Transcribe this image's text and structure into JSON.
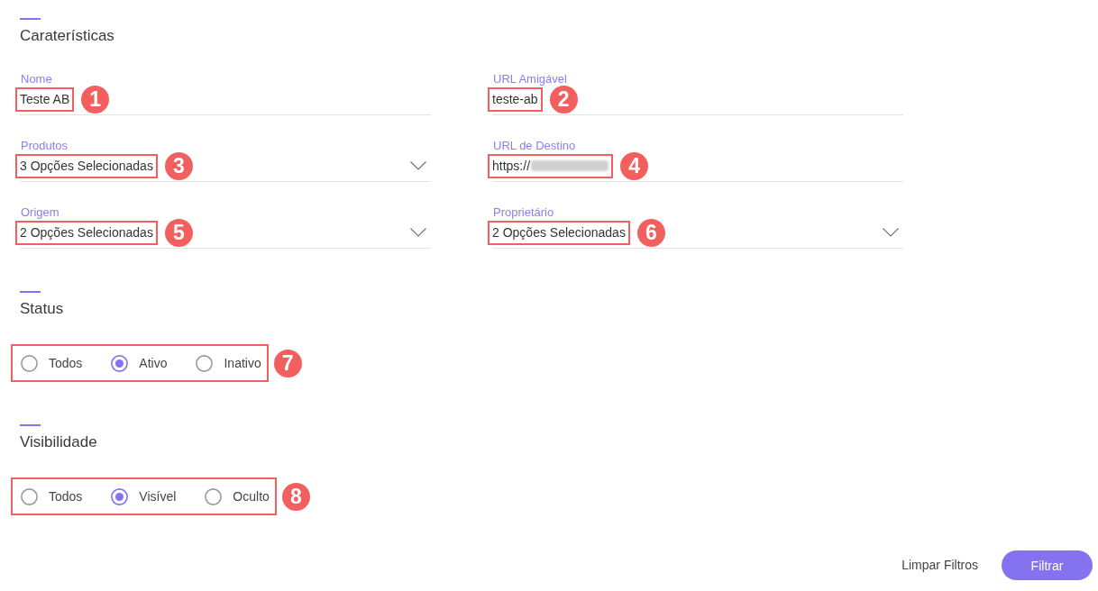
{
  "sections": [
    {
      "kind": "fields",
      "title": "Caraterísticas",
      "fields": [
        {
          "kind": "text",
          "label": "Nome",
          "value": "Teste AB",
          "callout": "1"
        },
        {
          "kind": "text",
          "label": "URL Amigável",
          "value": "teste-ab",
          "callout": "2"
        },
        {
          "kind": "select",
          "label": "Produtos",
          "value": "3 Opções Selecionadas",
          "callout": "3"
        },
        {
          "kind": "text",
          "label": "URL de Destino",
          "value": "https://",
          "redacted": true,
          "callout": "4"
        },
        {
          "kind": "select",
          "label": "Origem",
          "value": "2 Opções Selecionadas",
          "callout": "5"
        },
        {
          "kind": "select",
          "label": "Proprietário",
          "value": "2 Opções Selecionadas",
          "callout": "6"
        }
      ]
    },
    {
      "kind": "radios",
      "title": "Status",
      "callout": "7",
      "options": [
        {
          "label": "Todos",
          "selected": false
        },
        {
          "label": "Ativo",
          "selected": true
        },
        {
          "label": "Inativo",
          "selected": false
        }
      ]
    },
    {
      "kind": "radios",
      "title": "Visibilidade",
      "callout": "8",
      "options": [
        {
          "label": "Todos",
          "selected": false
        },
        {
          "label": "Visível",
          "selected": true
        },
        {
          "label": "Oculto",
          "selected": false
        }
      ]
    }
  ],
  "actions": [
    {
      "kind": "link",
      "label": "Limpar Filtros"
    },
    {
      "kind": "primary",
      "label": "Filtrar"
    }
  ]
}
